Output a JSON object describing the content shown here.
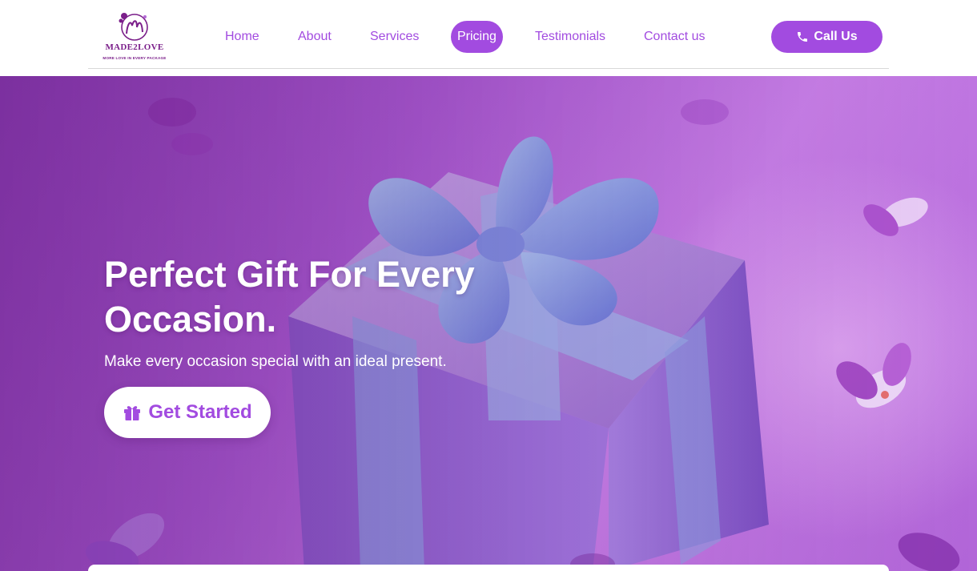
{
  "logo": {
    "word": "MADE2LOVE",
    "tagline": "MORE LOVE IN EVERY PACKAGE"
  },
  "nav": {
    "items": [
      {
        "label": "Home",
        "active": false
      },
      {
        "label": "About",
        "active": false
      },
      {
        "label": "Services",
        "active": false
      },
      {
        "label": "Pricing",
        "active": true
      },
      {
        "label": "Testimonials",
        "active": false
      },
      {
        "label": "Contact us",
        "active": false
      }
    ],
    "call_button": "Call Us"
  },
  "hero": {
    "title": "Perfect Gift For Every Occasion.",
    "subtitle": "Make every occasion special with an ideal present.",
    "cta_label": "Get Started"
  },
  "colors": {
    "accent": "#a24be0",
    "logo": "#7b1f8a"
  },
  "icons": {
    "call": "phone-icon",
    "cta": "gift-icon"
  }
}
